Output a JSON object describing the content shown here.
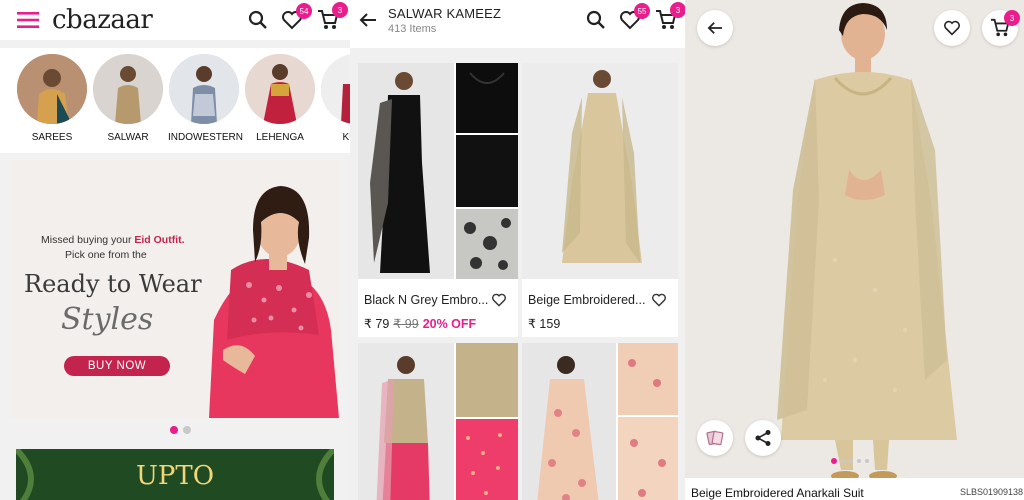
{
  "home": {
    "logo_text": "cbazaar",
    "wishlist_count": "54",
    "cart_count": "3",
    "categories": [
      {
        "label": "SAREES"
      },
      {
        "label": "SALWAR"
      },
      {
        "label": "INDOWESTERN"
      },
      {
        "label": "LEHENGA"
      },
      {
        "label": "KURT"
      }
    ],
    "banner": {
      "line1_prefix": "Missed buying your ",
      "line1_highlight": "Eid Outfit.",
      "line2": "Pick one from the",
      "headline": "Ready to Wear",
      "script": "Styles",
      "cta": "BUY NOW"
    },
    "promo2_text": "UPTO"
  },
  "listing": {
    "title": "SALWAR KAMEEZ",
    "count": "413 Items",
    "wishlist_count": "55",
    "cart_count": "3",
    "products": [
      {
        "name": "Black N Grey Embro...",
        "price": "₹ 79",
        "mrp": "₹ 99",
        "discount": "20% OFF"
      },
      {
        "name": "Beige Embroidered...",
        "price": "₹ 159",
        "mrp": "",
        "discount": ""
      }
    ]
  },
  "detail": {
    "cart_count": "3",
    "product_title": "Beige Embroidered Anarkali Suit",
    "sku": "SLBS01909138"
  },
  "colors": {
    "accent": "#e91e8c",
    "cta_bg": "#c2244e"
  }
}
